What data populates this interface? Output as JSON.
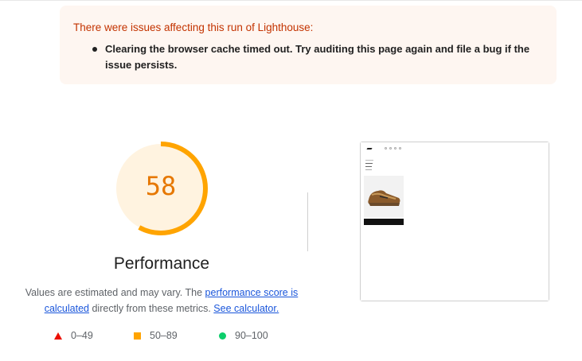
{
  "warning": {
    "title": "There were issues affecting this run of Lighthouse:",
    "items": [
      "Clearing the browser cache timed out. Try auditing this page again and file a bug if the issue persists."
    ]
  },
  "gauge": {
    "score": "58",
    "score_fraction": 0.58,
    "label": "Performance",
    "color": "#ffa400",
    "text_color": "#e67700",
    "background": "#fff3e0"
  },
  "description": {
    "text_1": "Values are estimated and may vary. The ",
    "link_1": "performance score is calculated",
    "text_2": " directly from these metrics. ",
    "link_2": "See calculator."
  },
  "legend": [
    {
      "shape": "triangle",
      "label": "0–49",
      "color": "#eb0f00"
    },
    {
      "shape": "square",
      "label": "50–89",
      "color": "#ffa400"
    },
    {
      "shape": "circle",
      "label": "90–100",
      "color": "#0cce6b"
    }
  ],
  "screenshot": {
    "description_icon": "page-screenshot-thumbnail"
  }
}
